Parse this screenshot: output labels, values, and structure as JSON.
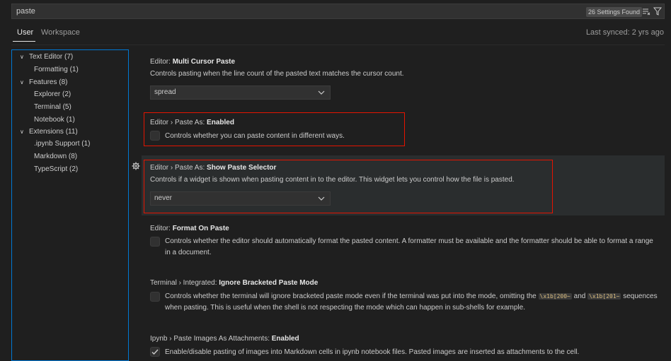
{
  "search": {
    "query": "paste",
    "found": "26 Settings Found"
  },
  "tabs": [
    {
      "label": "User"
    },
    {
      "label": "Workspace"
    }
  ],
  "synced": "Last synced: 2 yrs ago",
  "toc": [
    {
      "label": "Text Editor (7)",
      "expanded": true
    },
    {
      "label": "Formatting (1)"
    },
    {
      "label": "Features (8)",
      "expanded": true
    },
    {
      "label": "Explorer (2)"
    },
    {
      "label": "Terminal (5)"
    },
    {
      "label": "Notebook (1)"
    },
    {
      "label": "Extensions (11)",
      "expanded": true
    },
    {
      "label": ".ipynb Support (1)"
    },
    {
      "label": "Markdown (8)"
    },
    {
      "label": "TypeScript (2)"
    }
  ],
  "settings": [
    {
      "prefix": "Editor: ",
      "name": "Multi Cursor Paste",
      "description": "Controls pasting when the line count of the pasted text matches the cursor count.",
      "value": "spread"
    },
    {
      "prefix": "Editor › Paste As: ",
      "name": "Enabled",
      "description": "Controls whether you can paste content in different ways."
    },
    {
      "prefix": "Editor › Paste As: ",
      "name": "Show Paste Selector",
      "description": "Controls if a widget is shown when pasting content in to the editor. This widget lets you control how the file is pasted.",
      "value": "never"
    },
    {
      "prefix": "Editor: ",
      "name": "Format On Paste",
      "description": "Controls whether the editor should automatically format the pasted content. A formatter must be available and the formatter should be able to format a range in a document."
    },
    {
      "prefix": "Terminal › Integrated: ",
      "name": "Ignore Bracketed Paste Mode",
      "desc_part1": "Controls whether the terminal will ignore bracketed paste mode even if the terminal was put into the mode, omitting the ",
      "code1": "\\x1b[200~",
      "desc_mid": " and ",
      "code2": "\\x1b[201~",
      "desc_part2": " sequences when pasting. This is useful when the shell is not respecting the mode which can happen in sub-shells for example."
    },
    {
      "prefix": "Ipynb › Paste Images As Attachments: ",
      "name": "Enabled",
      "description": "Enable/disable pasting of images into Markdown cells in ipynb notebook files. Pasted images are inserted as attachments to the cell.",
      "checked": true
    }
  ],
  "colors": {
    "accent": "#0078d4",
    "highlight": "#e51400",
    "background": "#1f1f1f"
  }
}
